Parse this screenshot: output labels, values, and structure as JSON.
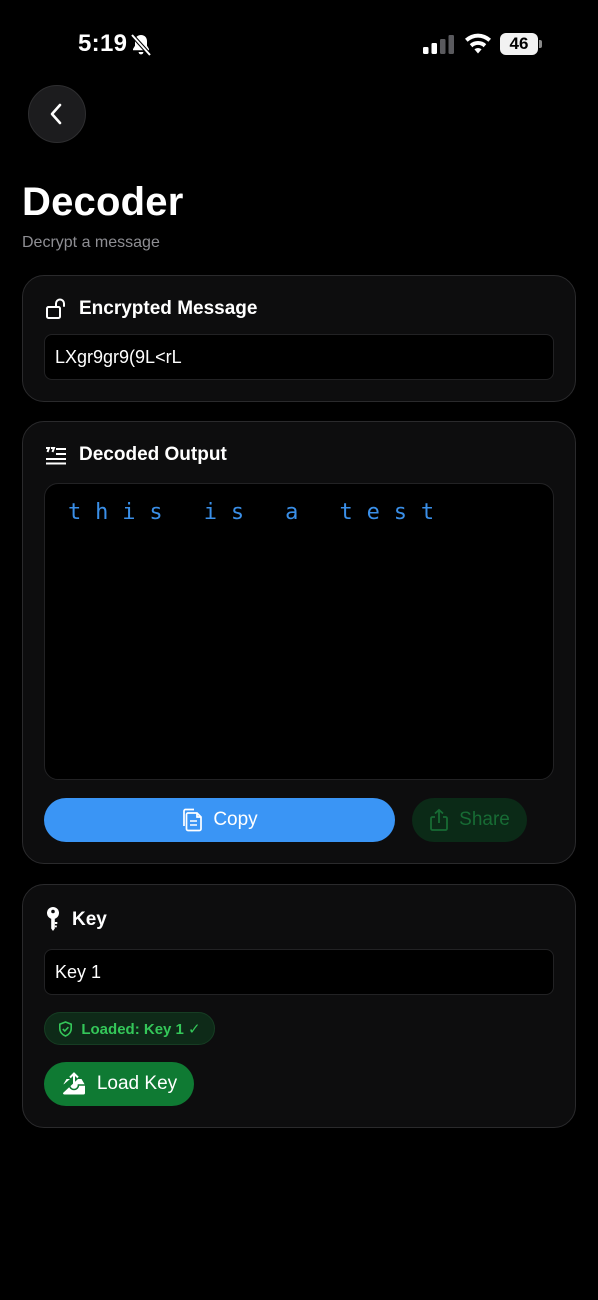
{
  "status_bar": {
    "time": "5:19",
    "battery": "46"
  },
  "header": {
    "title": "Decoder",
    "subtitle": "Decrypt a message"
  },
  "encrypted_card": {
    "title": "Encrypted Message",
    "value": "LXgr9gr9(9L<rL",
    "icon": "unlock-icon"
  },
  "output_card": {
    "title": "Decoded Output",
    "output": "this is a test",
    "copy_label": "Copy",
    "share_label": "Share",
    "icon": "text-quote-icon"
  },
  "key_card": {
    "title": "Key",
    "value": "Key 1",
    "badge": "Loaded: Key 1 ✓",
    "load_label": "Load Key",
    "icon": "key-icon"
  },
  "colors": {
    "accent_blue": "#3a95f5",
    "accent_green": "#0f7a33",
    "success_text": "#34c759",
    "output_text": "#3a8fe8"
  }
}
